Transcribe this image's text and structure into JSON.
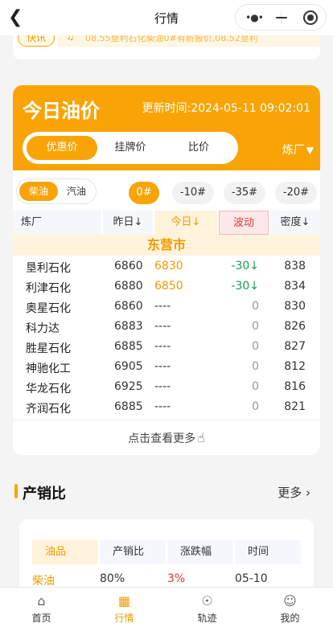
{
  "nav": {
    "back_icon": "chevron-left-icon",
    "title": "行情",
    "more_icon": "more-dots-icon",
    "minimize_icon": "minus-icon",
    "close_icon": "target-icon"
  },
  "notice": {
    "tag": "快讯",
    "text": "08.55垦利石化柴油0#有新报价,08.52垦利",
    "icon": "speaker-icon"
  },
  "price_card": {
    "title": "今日油价",
    "update_label": "更新时间:2024-05-11 09:02:01",
    "tabs": [
      {
        "label": "优惠价",
        "active": true
      },
      {
        "label": "挂牌价",
        "active": false
      },
      {
        "label": "比价",
        "active": false
      }
    ],
    "filter_label": "炼厂",
    "filter_icon": "funnel-icon",
    "fuel_types": [
      {
        "label": "柴油",
        "active": true
      },
      {
        "label": "汽油",
        "active": false
      }
    ],
    "grades": [
      {
        "label": "0#",
        "active": true
      },
      {
        "label": "-10#",
        "active": false
      },
      {
        "label": "-35#",
        "active": false
      },
      {
        "label": "-20#",
        "active": false
      }
    ],
    "columns": {
      "refinery": "炼厂",
      "yesterday": "昨日↓",
      "today": "今日↓",
      "fluctuation": "波动",
      "density": "密度↓"
    },
    "city": "东营市",
    "rows": [
      {
        "name": "垦利石化",
        "yesterday": "6860",
        "today": "6830",
        "fluct": "-30",
        "down": true,
        "density": "838"
      },
      {
        "name": "利津石化",
        "yesterday": "6880",
        "today": "6850",
        "fluct": "-30",
        "down": true,
        "density": "834"
      },
      {
        "name": "奥星石化",
        "yesterday": "6860",
        "today": "----",
        "fluct": "0",
        "down": false,
        "density": "830"
      },
      {
        "name": "科力达",
        "yesterday": "6883",
        "today": "----",
        "fluct": "0",
        "down": false,
        "density": "826"
      },
      {
        "name": "胜星石化",
        "yesterday": "6885",
        "today": "----",
        "fluct": "0",
        "down": false,
        "density": "827"
      },
      {
        "name": "神驰化工",
        "yesterday": "6905",
        "today": "----",
        "fluct": "0",
        "down": false,
        "density": "812"
      },
      {
        "name": "华龙石化",
        "yesterday": "6925",
        "today": "----",
        "fluct": "0",
        "down": false,
        "density": "816"
      },
      {
        "name": "齐润石化",
        "yesterday": "6885",
        "today": "----",
        "fluct": "0",
        "down": false,
        "density": "821"
      }
    ],
    "more_label": "点击查看更多",
    "more_icon": "hand-pointer-icon"
  },
  "ratio": {
    "title": "产销比",
    "more_label": "更多",
    "columns": [
      "油品",
      "产销比",
      "涨跌幅",
      "时间"
    ],
    "row": [
      "柴油",
      "80%",
      "3%",
      "05-10"
    ]
  },
  "tabbar": [
    {
      "label": "首页",
      "icon": "home-icon",
      "active": false
    },
    {
      "label": "行情",
      "icon": "market-icon",
      "active": true
    },
    {
      "label": "轨迹",
      "icon": "track-icon",
      "active": false
    },
    {
      "label": "我的",
      "icon": "smile-icon",
      "active": false
    }
  ],
  "colors": {
    "accent": "#f9a406",
    "down": "#17a34a",
    "fluct_header": "#e03a3a"
  }
}
